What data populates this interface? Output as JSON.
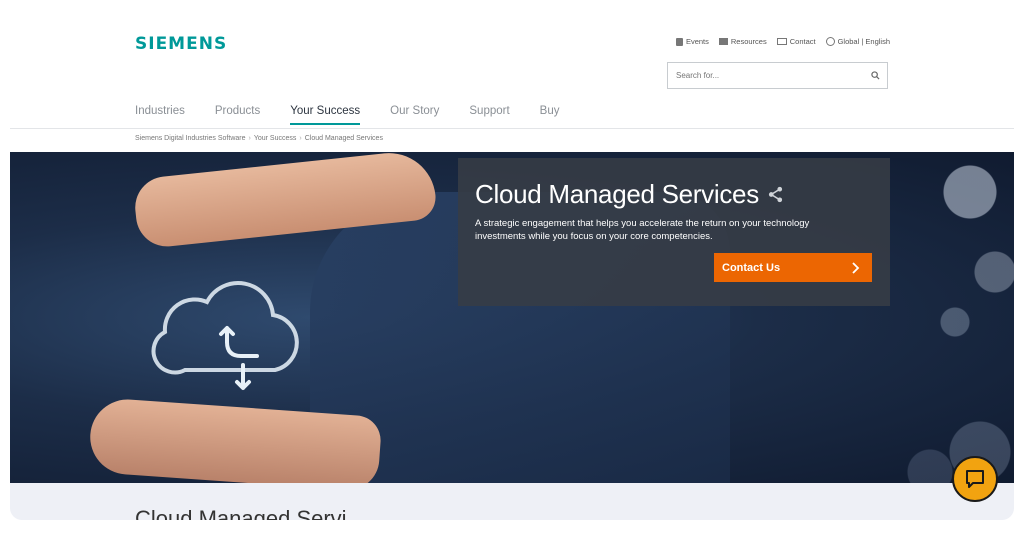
{
  "brand": {
    "logo_text": "SIEMENS",
    "accent": "#009999",
    "cta_color": "#ec6602"
  },
  "utility": [
    {
      "label": "Events",
      "icon": "calendar-icon"
    },
    {
      "label": "Resources",
      "icon": "document-icon"
    },
    {
      "label": "Contact",
      "icon": "mail-icon"
    },
    {
      "label": "Global | English",
      "icon": "globe-icon"
    }
  ],
  "search": {
    "placeholder": "Search for...",
    "icon": "search-icon"
  },
  "nav": {
    "items": [
      "Industries",
      "Products",
      "Your Success",
      "Our Story",
      "Support",
      "Buy"
    ],
    "active": "Your Success"
  },
  "breadcrumb": [
    "Siemens Digital Industries Software",
    "Your Success",
    "Cloud Managed Services"
  ],
  "hero": {
    "title": "Cloud Managed Services",
    "share_icon": "share-icon",
    "description": "A strategic engagement that helps you accelerate the return on your technology investments while you focus on your core competencies.",
    "cta_label": "Contact Us"
  },
  "section": {
    "partial_heading": "Cloud Managed Servi"
  },
  "chat": {
    "icon": "chat-icon",
    "color": "#f2a310"
  }
}
